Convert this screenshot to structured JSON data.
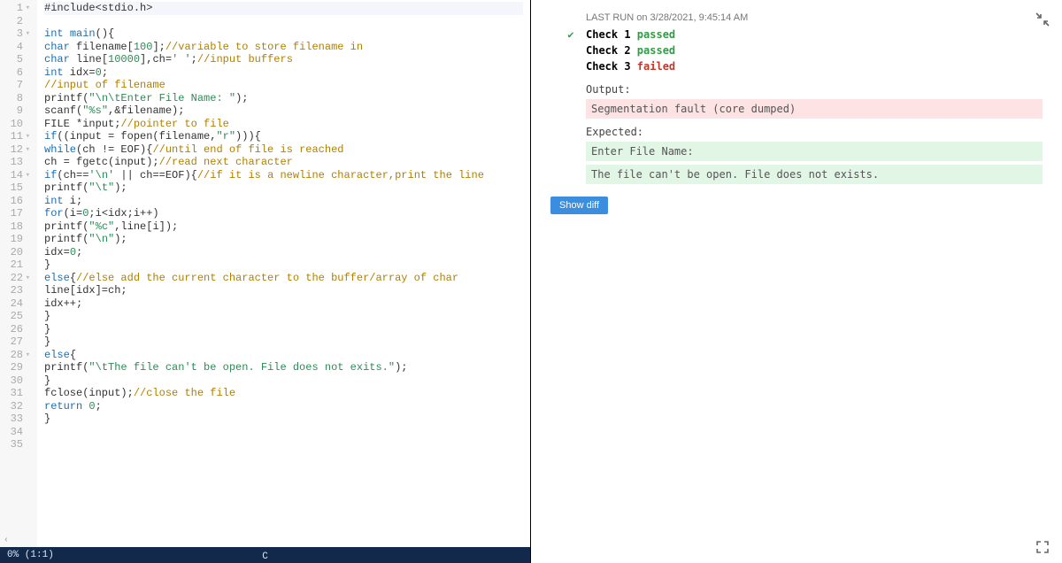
{
  "editor": {
    "language_mode": "C",
    "cursor_pos": "0% (1:1)",
    "lines": [
      {
        "n": 1,
        "fold": true,
        "tokens": [
          [
            "pp",
            "#include"
          ],
          [
            "id",
            "<stdio.h>"
          ]
        ]
      },
      {
        "n": 2,
        "fold": false,
        "tokens": []
      },
      {
        "n": 3,
        "fold": true,
        "tokens": [
          [
            "kw",
            "int"
          ],
          [
            "id",
            " "
          ],
          [
            "fn",
            "main"
          ],
          [
            "id",
            "(){"
          ]
        ]
      },
      {
        "n": 4,
        "fold": false,
        "tokens": [
          [
            "kw",
            "char"
          ],
          [
            "id",
            " filename["
          ],
          [
            "num",
            "100"
          ],
          [
            "id",
            "];"
          ],
          [
            "cm",
            "//variable to store filename in"
          ]
        ]
      },
      {
        "n": 5,
        "fold": false,
        "tokens": [
          [
            "kw",
            "char"
          ],
          [
            "id",
            " line["
          ],
          [
            "num",
            "10000"
          ],
          [
            "id",
            "],ch="
          ],
          [
            "str",
            "' '"
          ],
          [
            "id",
            ";"
          ],
          [
            "cm",
            "//input buffers"
          ]
        ]
      },
      {
        "n": 6,
        "fold": false,
        "tokens": [
          [
            "kw",
            "int"
          ],
          [
            "id",
            " idx="
          ],
          [
            "num",
            "0"
          ],
          [
            "id",
            ";"
          ]
        ]
      },
      {
        "n": 7,
        "fold": false,
        "tokens": [
          [
            "cm",
            "//input of filename"
          ]
        ]
      },
      {
        "n": 8,
        "fold": false,
        "tokens": [
          [
            "id",
            "printf("
          ],
          [
            "str",
            "\"\\n\\tEnter File Name: \""
          ],
          [
            "id",
            ");"
          ]
        ]
      },
      {
        "n": 9,
        "fold": false,
        "tokens": [
          [
            "id",
            "scanf("
          ],
          [
            "str",
            "\"%s\""
          ],
          [
            "id",
            ",&filename);"
          ]
        ]
      },
      {
        "n": 10,
        "fold": false,
        "tokens": [
          [
            "id",
            "FILE *input;"
          ],
          [
            "cm",
            "//pointer to file"
          ]
        ]
      },
      {
        "n": 11,
        "fold": true,
        "tokens": [
          [
            "kw",
            "if"
          ],
          [
            "id",
            "((input = fopen(filename,"
          ],
          [
            "str",
            "\"r\""
          ],
          [
            "id",
            "))){"
          ]
        ]
      },
      {
        "n": 12,
        "fold": true,
        "tokens": [
          [
            "kw",
            "while"
          ],
          [
            "id",
            "(ch != EOF){"
          ],
          [
            "cm",
            "//until end of file is reached"
          ]
        ]
      },
      {
        "n": 13,
        "fold": false,
        "tokens": [
          [
            "id",
            "ch = fgetc(input);"
          ],
          [
            "cm",
            "//read next character"
          ]
        ]
      },
      {
        "n": 14,
        "fold": true,
        "tokens": [
          [
            "kw",
            "if"
          ],
          [
            "id",
            "(ch=="
          ],
          [
            "str",
            "'\\n'"
          ],
          [
            "id",
            " || ch==EOF){"
          ],
          [
            "cm",
            "//if it is a newline character,print the line"
          ]
        ]
      },
      {
        "n": 15,
        "fold": false,
        "tokens": [
          [
            "id",
            "printf("
          ],
          [
            "str",
            "\"\\t\""
          ],
          [
            "id",
            ");"
          ]
        ]
      },
      {
        "n": 16,
        "fold": false,
        "tokens": [
          [
            "kw",
            "int"
          ],
          [
            "id",
            " i;"
          ]
        ]
      },
      {
        "n": 17,
        "fold": false,
        "tokens": [
          [
            "kw",
            "for"
          ],
          [
            "id",
            "(i="
          ],
          [
            "num",
            "0"
          ],
          [
            "id",
            ";i<idx;i++)"
          ]
        ]
      },
      {
        "n": 18,
        "fold": false,
        "tokens": [
          [
            "id",
            "printf("
          ],
          [
            "str",
            "\"%c\""
          ],
          [
            "id",
            ",line[i]);"
          ]
        ]
      },
      {
        "n": 19,
        "fold": false,
        "tokens": [
          [
            "id",
            "printf("
          ],
          [
            "str",
            "\"\\n\""
          ],
          [
            "id",
            ");"
          ]
        ]
      },
      {
        "n": 20,
        "fold": false,
        "tokens": [
          [
            "id",
            "idx="
          ],
          [
            "num",
            "0"
          ],
          [
            "id",
            ";"
          ]
        ]
      },
      {
        "n": 21,
        "fold": false,
        "tokens": [
          [
            "id",
            "}"
          ]
        ]
      },
      {
        "n": 22,
        "fold": true,
        "tokens": [
          [
            "kw",
            "else"
          ],
          [
            "id",
            "{"
          ],
          [
            "cm",
            "//else add the current character to the buffer/array of char"
          ]
        ]
      },
      {
        "n": 23,
        "fold": false,
        "tokens": [
          [
            "id",
            "line[idx]=ch;"
          ]
        ]
      },
      {
        "n": 24,
        "fold": false,
        "tokens": [
          [
            "id",
            "idx++;"
          ]
        ]
      },
      {
        "n": 25,
        "fold": false,
        "tokens": [
          [
            "id",
            "}"
          ]
        ]
      },
      {
        "n": 26,
        "fold": false,
        "tokens": [
          [
            "id",
            "}"
          ]
        ]
      },
      {
        "n": 27,
        "fold": false,
        "tokens": [
          [
            "id",
            "}"
          ]
        ]
      },
      {
        "n": 28,
        "fold": true,
        "tokens": [
          [
            "kw",
            "else"
          ],
          [
            "id",
            "{"
          ]
        ]
      },
      {
        "n": 29,
        "fold": false,
        "tokens": [
          [
            "id",
            "printf("
          ],
          [
            "str",
            "\"\\tThe file can't be open. File does not exits.\""
          ],
          [
            "id",
            ");"
          ]
        ]
      },
      {
        "n": 30,
        "fold": false,
        "tokens": [
          [
            "id",
            "}"
          ]
        ]
      },
      {
        "n": 31,
        "fold": false,
        "tokens": [
          [
            "id",
            "fclose(input);"
          ],
          [
            "cm",
            "//close the file"
          ]
        ]
      },
      {
        "n": 32,
        "fold": false,
        "tokens": [
          [
            "kw",
            "return"
          ],
          [
            "id",
            " "
          ],
          [
            "num",
            "0"
          ],
          [
            "id",
            ";"
          ]
        ]
      },
      {
        "n": 33,
        "fold": false,
        "tokens": [
          [
            "id",
            "}"
          ]
        ]
      },
      {
        "n": 34,
        "fold": false,
        "tokens": []
      },
      {
        "n": 35,
        "fold": false,
        "tokens": []
      }
    ]
  },
  "results": {
    "last_run_label": "LAST RUN on 3/28/2021, 9:45:14 AM",
    "checks": [
      {
        "label": "Check 1",
        "status": "passed"
      },
      {
        "label": "Check 2",
        "status": "passed"
      },
      {
        "label": "Check 3",
        "status": "failed"
      }
    ],
    "output_label": "Output:",
    "output_text": "Segmentation fault (core dumped)",
    "expected_label": "Expected:",
    "expected_lines": [
      "Enter File Name:",
      "The file can't be open. File does not exists."
    ],
    "show_diff_label": "Show diff"
  },
  "scroll_indicator": "‹"
}
